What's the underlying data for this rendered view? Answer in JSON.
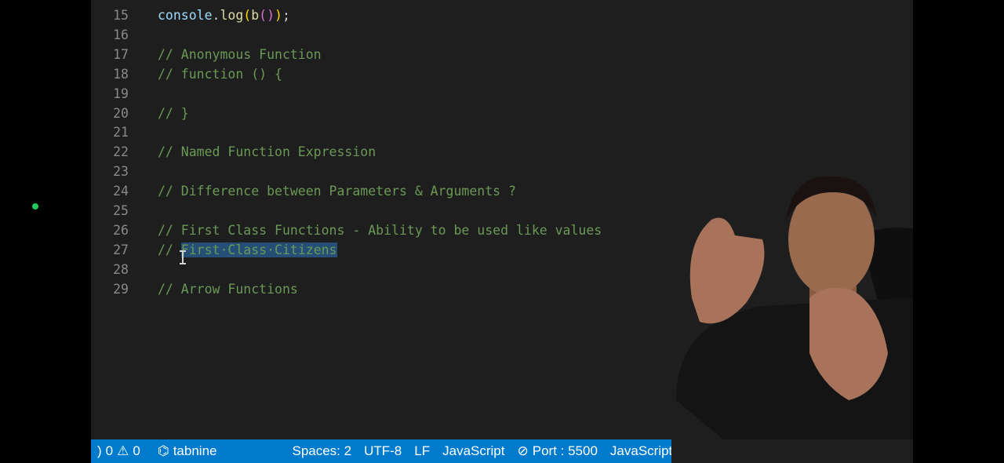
{
  "editor": {
    "lines": [
      {
        "num": "15",
        "parts": [
          {
            "t": "console",
            "c": "tok-ident"
          },
          {
            "t": ".",
            "c": "tok-plain"
          },
          {
            "t": "log",
            "c": "tok-fn"
          },
          {
            "t": "(",
            "c": "tok-paren1"
          },
          {
            "t": "b",
            "c": "tok-fn"
          },
          {
            "t": "(",
            "c": "tok-paren2"
          },
          {
            "t": ")",
            "c": "tok-paren2"
          },
          {
            "t": ")",
            "c": "tok-paren1"
          },
          {
            "t": ";",
            "c": "tok-plain"
          }
        ]
      },
      {
        "num": "16",
        "parts": []
      },
      {
        "num": "17",
        "parts": [
          {
            "t": "// Anonymous Function",
            "c": "comment"
          }
        ]
      },
      {
        "num": "18",
        "parts": [
          {
            "t": "// function () {",
            "c": "comment"
          }
        ]
      },
      {
        "num": "19",
        "parts": []
      },
      {
        "num": "20",
        "parts": [
          {
            "t": "// }",
            "c": "comment"
          }
        ]
      },
      {
        "num": "21",
        "parts": []
      },
      {
        "num": "22",
        "parts": [
          {
            "t": "// Named Function Expression",
            "c": "comment"
          }
        ]
      },
      {
        "num": "23",
        "parts": []
      },
      {
        "num": "24",
        "parts": [
          {
            "t": "// Difference between Parameters & Arguments ?",
            "c": "comment"
          }
        ]
      },
      {
        "num": "25",
        "parts": []
      },
      {
        "num": "26",
        "parts": [
          {
            "t": "// First Class Functions - Ability to be used like values",
            "c": "comment"
          }
        ]
      },
      {
        "num": "27",
        "parts": [
          {
            "t": "// ",
            "c": "comment"
          },
          {
            "t": "First·Class·Citizens",
            "c": "selection"
          }
        ]
      },
      {
        "num": "28",
        "parts": []
      },
      {
        "num": "29",
        "parts": [
          {
            "t": "// Arrow Functions",
            "c": "comment"
          }
        ]
      }
    ]
  },
  "statusbar": {
    "problems_errors": "0",
    "problems_warnings": "0",
    "tabnine": "tabnine",
    "spaces": "Spaces: 2",
    "encoding": "UTF-8",
    "eol": "LF",
    "language": "JavaScript",
    "port": "Port : 5500",
    "language2": "JavaScript"
  },
  "colors": {
    "statusbar_bg": "#007acc",
    "editor_bg": "#1e1e1e",
    "comment": "#6a9955",
    "selection": "#264f78"
  }
}
